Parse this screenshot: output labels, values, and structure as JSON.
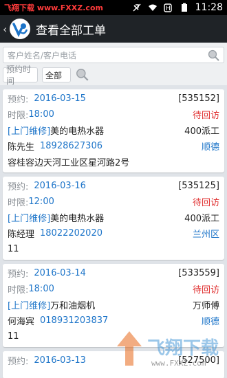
{
  "statusbar": {
    "watermark": "飞翔下载 www.FXXZ.com",
    "time": "11:28"
  },
  "header": {
    "back": "‹",
    "title": "查看全部工单"
  },
  "search": {
    "placeholder": "客户姓名/客户电话"
  },
  "filters": {
    "date_placeholder": "预约时间",
    "scope": "全部"
  },
  "orders": [
    {
      "appt_label": "预约:",
      "appt_date": "2016-03-15",
      "id": "[535152]",
      "deadline_label": "时限:",
      "deadline": "18:00",
      "status": "待回访",
      "type": "[上门维修]",
      "product": "美的电热水器",
      "worker": "400派工",
      "customer": "陈先生",
      "phone": "18928627306",
      "area": "顺德",
      "address": "容桂容边天河工业区星河路2号"
    },
    {
      "appt_label": "预约:",
      "appt_date": "2016-03-16",
      "id": "[535125]",
      "deadline_label": "时限:",
      "deadline": "12:00",
      "status": "待回访",
      "type": "[上门维修]",
      "product": "美的电热水器",
      "worker": "400派工",
      "customer": "陈经理",
      "phone": "18022202020",
      "area": "兰州区",
      "address": "11"
    },
    {
      "appt_label": "预约:",
      "appt_date": "2016-03-14",
      "id": "[533559]",
      "deadline_label": "时限:",
      "deadline": "18:00",
      "status": "待回访",
      "type": "[上门维修]",
      "product": "万和油烟机",
      "worker": "万师傅",
      "customer": "何海宾",
      "phone": "018931203837",
      "area": "顺德",
      "address": "11"
    },
    {
      "appt_label": "预约:",
      "appt_date": "2016-03-13",
      "id": "[527500]"
    }
  ],
  "bottom_watermark": {
    "text": "飞翔下载",
    "url": "www.FXXZ.com"
  }
}
